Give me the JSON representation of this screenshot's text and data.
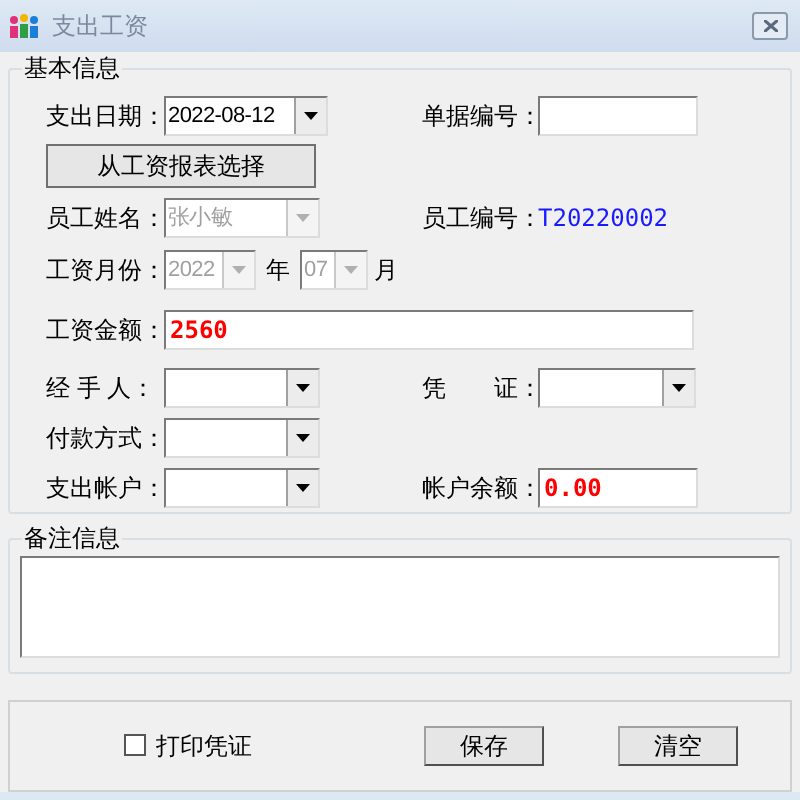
{
  "window": {
    "title": "支出工资"
  },
  "basic_info": {
    "title": "基本信息",
    "payment_date": {
      "label": "支出日期：",
      "value": "2022-08-12",
      "disabled": false
    },
    "receipt_no": {
      "label": "单据编号："
    },
    "select_button": "从工资报表选择",
    "employee_name": {
      "label": "员工姓名：",
      "value": "张小敏",
      "disabled": true
    },
    "employee_id": {
      "label": "员工编号：",
      "value": "T20220002"
    },
    "salary_month": {
      "label": "工资月份：",
      "year": "2022",
      "year_unit": "年",
      "month": "07",
      "month_unit": "月",
      "disabled": true
    },
    "amount": {
      "label": "工资金额：",
      "value": "2560"
    },
    "handler": {
      "label": "经 手 人：",
      "disabled": false
    },
    "voucher": {
      "label": "凭　　证：",
      "disabled": false
    },
    "payment_method": {
      "label": "付款方式：",
      "disabled": false
    },
    "account": {
      "label": "支出帐户：",
      "disabled": false
    },
    "balance": {
      "label": "帐户余额：",
      "value": "0.00"
    }
  },
  "remarks": {
    "title": "备注信息"
  },
  "print_voucher": {
    "label": "打印凭证",
    "checked": false
  },
  "buttons": [
    "保存",
    "清空"
  ]
}
